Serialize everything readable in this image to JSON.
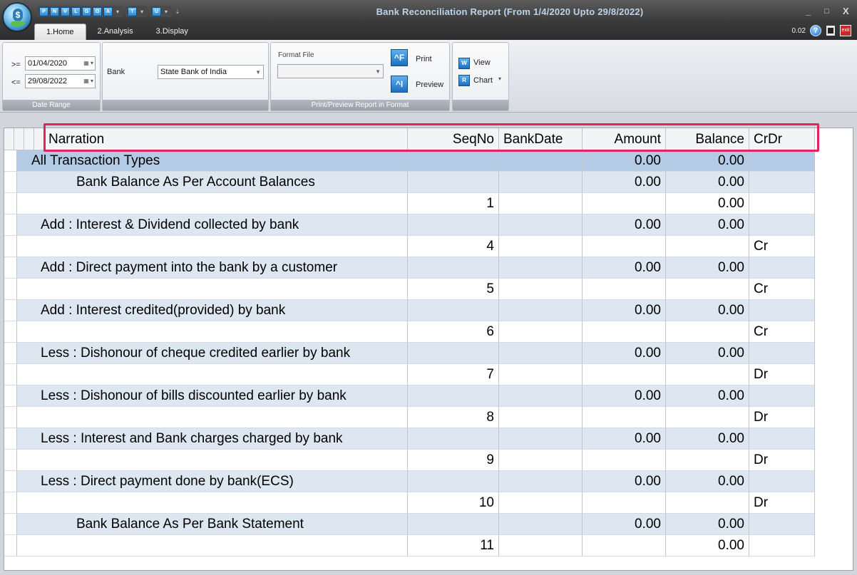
{
  "window": {
    "title": "Bank Reconciliation Report (From 1/4/2020 Upto 29/8/2022)",
    "minimize": "_",
    "maximize": "□",
    "close": "X"
  },
  "quick_access": [
    "P",
    "N",
    "V",
    "L",
    "G",
    "O",
    "A",
    "T",
    "U"
  ],
  "tabs": [
    "1.Home",
    "2.Analysis",
    "3.Display"
  ],
  "status": {
    "zoom": "0.02",
    "help": "?",
    "exit": "exit"
  },
  "ribbon": {
    "date_range": {
      "from_op": ">=",
      "from_value": "01/04/2020",
      "to_op": "<=",
      "to_value": "29/08/2022",
      "group_label": "Date Range"
    },
    "bank": {
      "label": "Bank",
      "value": "State Bank of India"
    },
    "print": {
      "format_label": "Format File",
      "format_value": "",
      "print_label": "Print",
      "preview_label": "Preview",
      "group_label": "Print/Preview Report in Format"
    },
    "view": {
      "view_label": "View",
      "chart_label": "Chart"
    }
  },
  "grid": {
    "columns": [
      "Narration",
      "SeqNo",
      "BankDate",
      "Amount",
      "Balance",
      "CrDr"
    ],
    "rows": [
      {
        "narration": "All Transaction Types",
        "seq": "",
        "date": "",
        "amount": "0.00",
        "balance": "0.00",
        "crdr": "",
        "indent": 0,
        "style": "sel"
      },
      {
        "narration": "Bank Balance As Per Account Balances",
        "seq": "",
        "date": "",
        "amount": "0.00",
        "balance": "0.00",
        "crdr": "",
        "indent": 2,
        "style": "alt"
      },
      {
        "narration": "",
        "seq": "1",
        "date": "",
        "amount": "",
        "balance": "0.00",
        "crdr": "",
        "indent": 0,
        "style": ""
      },
      {
        "narration": "Add  : Interest & Dividend collected by bank",
        "seq": "",
        "date": "",
        "amount": "0.00",
        "balance": "0.00",
        "crdr": "",
        "indent": 1,
        "style": "alt"
      },
      {
        "narration": "",
        "seq": "4",
        "date": "",
        "amount": "",
        "balance": "",
        "crdr": "Cr",
        "indent": 0,
        "style": ""
      },
      {
        "narration": "Add  : Direct payment into the bank by a customer",
        "seq": "",
        "date": "",
        "amount": "0.00",
        "balance": "0.00",
        "crdr": "",
        "indent": 1,
        "style": "alt"
      },
      {
        "narration": "",
        "seq": "5",
        "date": "",
        "amount": "",
        "balance": "",
        "crdr": "Cr",
        "indent": 0,
        "style": ""
      },
      {
        "narration": "Add  : Interest credited(provided) by bank",
        "seq": "",
        "date": "",
        "amount": "0.00",
        "balance": "0.00",
        "crdr": "",
        "indent": 1,
        "style": "alt"
      },
      {
        "narration": "",
        "seq": "6",
        "date": "",
        "amount": "",
        "balance": "",
        "crdr": "Cr",
        "indent": 0,
        "style": ""
      },
      {
        "narration": "Less : Dishonour of cheque credited earlier by bank",
        "seq": "",
        "date": "",
        "amount": "0.00",
        "balance": "0.00",
        "crdr": "",
        "indent": 1,
        "style": "alt"
      },
      {
        "narration": "",
        "seq": "7",
        "date": "",
        "amount": "",
        "balance": "",
        "crdr": "Dr",
        "indent": 0,
        "style": ""
      },
      {
        "narration": "Less : Dishonour of bills discounted earlier by bank",
        "seq": "",
        "date": "",
        "amount": "0.00",
        "balance": "0.00",
        "crdr": "",
        "indent": 1,
        "style": "alt"
      },
      {
        "narration": "",
        "seq": "8",
        "date": "",
        "amount": "",
        "balance": "",
        "crdr": "Dr",
        "indent": 0,
        "style": ""
      },
      {
        "narration": "Less : Interest and Bank charges charged by bank",
        "seq": "",
        "date": "",
        "amount": "0.00",
        "balance": "0.00",
        "crdr": "",
        "indent": 1,
        "style": "alt"
      },
      {
        "narration": "",
        "seq": "9",
        "date": "",
        "amount": "",
        "balance": "",
        "crdr": "Dr",
        "indent": 0,
        "style": ""
      },
      {
        "narration": "Less : Direct payment done by bank(ECS)",
        "seq": "",
        "date": "",
        "amount": "0.00",
        "balance": "0.00",
        "crdr": "",
        "indent": 1,
        "style": "alt"
      },
      {
        "narration": "",
        "seq": "10",
        "date": "",
        "amount": "",
        "balance": "",
        "crdr": "Dr",
        "indent": 0,
        "style": ""
      },
      {
        "narration": "Bank Balance As Per Bank Statement",
        "seq": "",
        "date": "",
        "amount": "0.00",
        "balance": "0.00",
        "crdr": "",
        "indent": 2,
        "style": "alt"
      },
      {
        "narration": "",
        "seq": "11",
        "date": "",
        "amount": "",
        "balance": "0.00",
        "crdr": "",
        "indent": 0,
        "style": ""
      }
    ]
  },
  "colors": {
    "selected_row": "#b4cbe6",
    "alt_row": "#dde7f2",
    "highlight_border": "#e0245e",
    "title_text": "#bcd3ea"
  }
}
